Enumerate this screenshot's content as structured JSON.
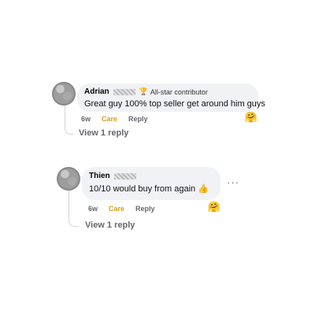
{
  "comments": [
    {
      "author": "Adrian",
      "badge": "All-star contributor",
      "text": "Great guy 100% top seller get around him guys",
      "time": "6w",
      "care": "Care",
      "reply": "Reply",
      "reaction": "🤗",
      "view_replies": "View 1 reply"
    },
    {
      "author": "Thien",
      "text": "10/10 would buy from again 👍",
      "time": "6w",
      "care": "Care",
      "reply": "Reply",
      "reaction": "🤗",
      "more": "···",
      "view_replies": "View 1 reply"
    }
  ],
  "icons": {
    "badge": "trophy-icon",
    "more": "more-options-icon"
  },
  "colors": {
    "bubble": "#f0f2f5",
    "care": "#d4a017",
    "muted": "#65676b"
  }
}
